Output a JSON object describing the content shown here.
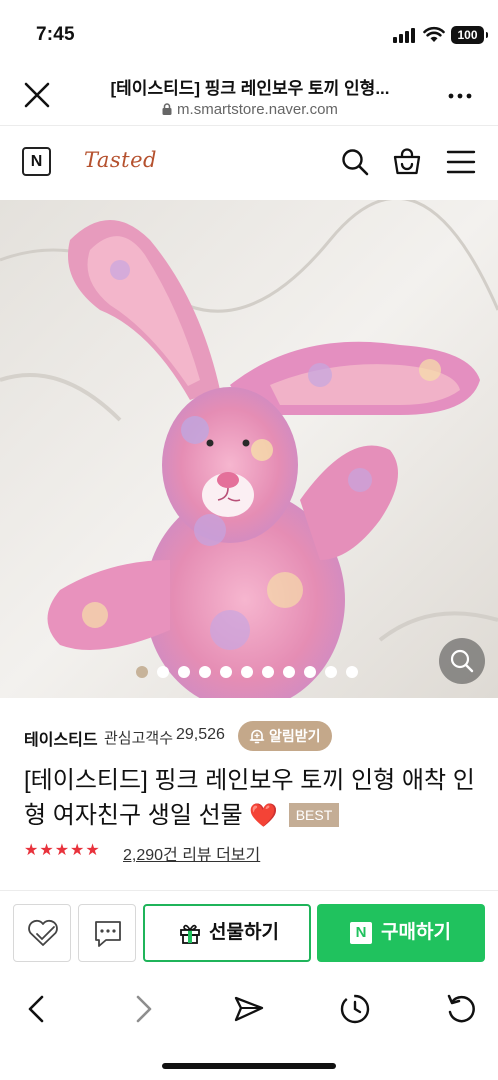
{
  "status_bar": {
    "time": "7:45",
    "battery": "100"
  },
  "browser": {
    "page_title": "[테이스티드] 핑크 레인보우 토끼 인형...",
    "url": "m.smartstore.naver.com"
  },
  "store": {
    "naver_logo": "N",
    "brand_logo": "Tasted"
  },
  "gallery": {
    "total_images": 11,
    "current_index": 1
  },
  "seller": {
    "name": "테이스티드",
    "follower_label": "관심고객수",
    "follower_count": "29,526",
    "alarm_label": "알림받기"
  },
  "product": {
    "title": "[테이스티드] 핑크 레인보우 토끼 인형 애착 인형 여자친구 생일 선물",
    "heart": "❤️",
    "badge": "BEST",
    "rating_stars": 5,
    "stars_text": "★★★★★",
    "review_text": "2,290건 리뷰 더보기"
  },
  "actions": {
    "gift_label": "선물하기",
    "buy_badge": "N",
    "buy_label": "구매하기"
  },
  "colors": {
    "buy_green": "#20c25e",
    "brand_beige": "#c4a88a",
    "star_red": "#e8323c"
  }
}
